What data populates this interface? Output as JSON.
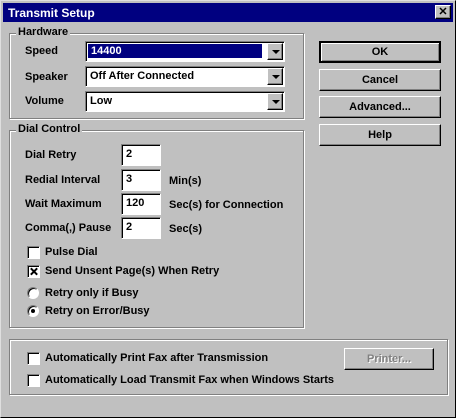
{
  "window": {
    "title": "Transmit Setup",
    "close_glyph": "✕"
  },
  "hardware": {
    "label": "Hardware",
    "speed_label": "Speed",
    "speed_value": "14400",
    "speaker_label": "Speaker",
    "speaker_value": "Off After Connected",
    "volume_label": "Volume",
    "volume_value": "Low"
  },
  "dial_control": {
    "label": "Dial Control",
    "dial_retry_label": "Dial Retry",
    "dial_retry_value": "2",
    "redial_interval_label": "Redial Interval",
    "redial_interval_value": "3",
    "redial_interval_unit": "Min(s)",
    "wait_maximum_label": "Wait Maximum",
    "wait_maximum_value": "120",
    "wait_maximum_unit": "Sec(s) for Connection",
    "comma_pause_label": "Comma(,) Pause",
    "comma_pause_value": "2",
    "comma_pause_unit": "Sec(s)",
    "pulse_dial_label": "Pulse Dial",
    "pulse_dial_checked": false,
    "send_unsent_label": "Send Unsent Page(s) When Retry",
    "send_unsent_checked": true,
    "retry_busy_label": "Retry only if Busy",
    "retry_error_label": "Retry on Error/Busy",
    "selected_retry": "retry_error"
  },
  "buttons": {
    "ok": "OK",
    "cancel": "Cancel",
    "advanced": "Advanced...",
    "help": "Help",
    "printer": "Printer..."
  },
  "bottom": {
    "auto_print_label": "Automatically Print Fax after Transmission",
    "auto_print_checked": false,
    "auto_load_label": "Automatically Load Transmit Fax when Windows Starts",
    "auto_load_checked": false
  }
}
